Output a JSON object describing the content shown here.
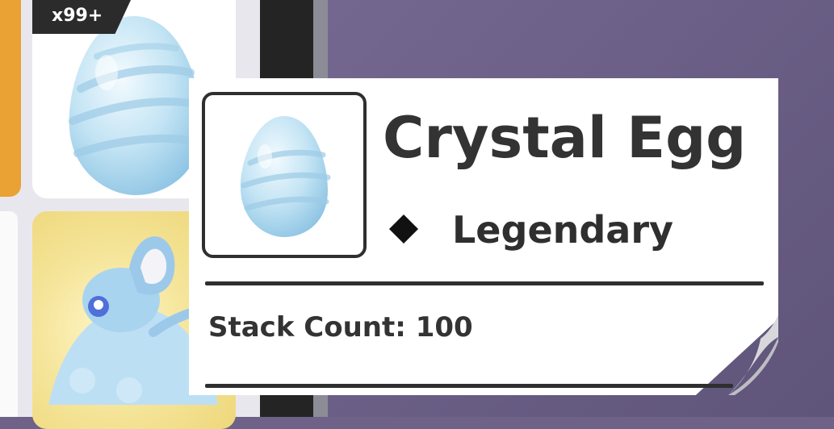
{
  "inventory": {
    "stack_badge": "x99+"
  },
  "tooltip": {
    "item_name": "Crystal Egg",
    "rarity": "Legendary",
    "stack_count_text": "Stack Count: 100",
    "item_icon": "crystal-egg-icon",
    "rarity_icon": "diamond-icon"
  },
  "colors": {
    "background": "#6e6288",
    "egg_light": "#e6f4fb",
    "egg_mid": "#b9dff2",
    "egg_shadow": "#8ec6e6",
    "text_dark": "#333333",
    "orange_accent": "#e9a233"
  }
}
